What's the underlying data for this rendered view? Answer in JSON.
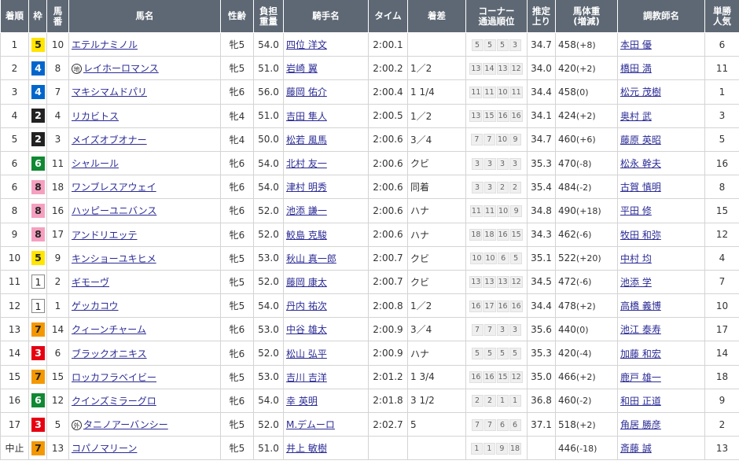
{
  "headers": [
    "着順",
    "枠",
    "馬\n番",
    "馬名",
    "性齢",
    "負担\n重量",
    "騎手名",
    "タイム",
    "着差",
    "コーナー\n通過順位",
    "推定\n上り",
    "馬体重\n(増減)",
    "調教師名",
    "単勝\n人気"
  ],
  "rows": [
    {
      "rank": "1",
      "frame": "5",
      "num": "10",
      "mark": "",
      "horse": "エテルナミノル",
      "sexage": "牝5",
      "weight": "54.0",
      "jockey": "四位 洋文",
      "time": "2:00.1",
      "margin": "",
      "corner": [
        "5",
        "5",
        "5",
        "3"
      ],
      "last3f": "34.7",
      "body": "458",
      "diff": "(+8)",
      "trainer": "本田 優",
      "pop": "6"
    },
    {
      "rank": "2",
      "frame": "4",
      "num": "8",
      "mark": "地",
      "horse": "レイホーロマンス",
      "sexage": "牝5",
      "weight": "51.0",
      "jockey": "岩崎 翼",
      "time": "2:00.2",
      "margin": "1／2",
      "corner": [
        "13",
        "14",
        "13",
        "12"
      ],
      "last3f": "34.0",
      "body": "420",
      "diff": "(+2)",
      "trainer": "橋田 満",
      "pop": "11"
    },
    {
      "rank": "3",
      "frame": "4",
      "num": "7",
      "mark": "",
      "horse": "マキシマムドパリ",
      "sexage": "牝6",
      "weight": "56.0",
      "jockey": "藤岡 佑介",
      "time": "2:00.4",
      "margin": "1 1/4",
      "corner": [
        "11",
        "11",
        "10",
        "11"
      ],
      "last3f": "34.4",
      "body": "458",
      "diff": "(0)",
      "trainer": "松元 茂樹",
      "pop": "1"
    },
    {
      "rank": "4",
      "frame": "2",
      "num": "4",
      "mark": "",
      "horse": "リカビトス",
      "sexage": "牝4",
      "weight": "51.0",
      "jockey": "吉田 隼人",
      "time": "2:00.5",
      "margin": "1／2",
      "corner": [
        "13",
        "15",
        "16",
        "16"
      ],
      "last3f": "34.1",
      "body": "424",
      "diff": "(+2)",
      "trainer": "奥村 武",
      "pop": "3"
    },
    {
      "rank": "5",
      "frame": "2",
      "num": "3",
      "mark": "",
      "horse": "メイズオブオナー",
      "sexage": "牝4",
      "weight": "50.0",
      "jockey": "松若 風馬",
      "time": "2:00.6",
      "margin": "3／4",
      "corner": [
        "7",
        "7",
        "10",
        "9"
      ],
      "last3f": "34.7",
      "body": "460",
      "diff": "(+6)",
      "trainer": "藤原 英昭",
      "pop": "5"
    },
    {
      "rank": "6",
      "frame": "6",
      "num": "11",
      "mark": "",
      "horse": "シャルール",
      "sexage": "牝6",
      "weight": "54.0",
      "jockey": "北村 友一",
      "time": "2:00.6",
      "margin": "クビ",
      "corner": [
        "3",
        "3",
        "3",
        "3"
      ],
      "last3f": "35.3",
      "body": "470",
      "diff": "(-8)",
      "trainer": "松永 幹夫",
      "pop": "16"
    },
    {
      "rank": "6",
      "frame": "8",
      "num": "18",
      "mark": "",
      "horse": "ワンブレスアウェイ",
      "sexage": "牝6",
      "weight": "54.0",
      "jockey": "津村 明秀",
      "time": "2:00.6",
      "margin": "同着",
      "corner": [
        "3",
        "3",
        "2",
        "2"
      ],
      "last3f": "35.4",
      "body": "484",
      "diff": "(-2)",
      "trainer": "古賀 慎明",
      "pop": "8"
    },
    {
      "rank": "8",
      "frame": "8",
      "num": "16",
      "mark": "",
      "horse": "ハッピーユニバンス",
      "sexage": "牝6",
      "weight": "52.0",
      "jockey": "池添 謙一",
      "time": "2:00.6",
      "margin": "ハナ",
      "corner": [
        "11",
        "11",
        "10",
        "9"
      ],
      "last3f": "34.8",
      "body": "490",
      "diff": "(+18)",
      "trainer": "平田 修",
      "pop": "15"
    },
    {
      "rank": "9",
      "frame": "8",
      "num": "17",
      "mark": "",
      "horse": "アンドリエッテ",
      "sexage": "牝6",
      "weight": "52.0",
      "jockey": "鮫島 克駿",
      "time": "2:00.6",
      "margin": "ハナ",
      "corner": [
        "18",
        "18",
        "16",
        "15"
      ],
      "last3f": "34.3",
      "body": "462",
      "diff": "(-6)",
      "trainer": "牧田 和弥",
      "pop": "12"
    },
    {
      "rank": "10",
      "frame": "5",
      "num": "9",
      "mark": "",
      "horse": "キンショーユキヒメ",
      "sexage": "牝5",
      "weight": "53.0",
      "jockey": "秋山 真一郎",
      "time": "2:00.7",
      "margin": "クビ",
      "corner": [
        "10",
        "10",
        "6",
        "5"
      ],
      "last3f": "35.1",
      "body": "522",
      "diff": "(+20)",
      "trainer": "中村 均",
      "pop": "4"
    },
    {
      "rank": "11",
      "frame": "1",
      "num": "2",
      "mark": "",
      "horse": "ギモーヴ",
      "sexage": "牝5",
      "weight": "52.0",
      "jockey": "藤岡 康太",
      "time": "2:00.7",
      "margin": "クビ",
      "corner": [
        "13",
        "13",
        "13",
        "12"
      ],
      "last3f": "34.5",
      "body": "472",
      "diff": "(-6)",
      "trainer": "池添 学",
      "pop": "7"
    },
    {
      "rank": "12",
      "frame": "1",
      "num": "1",
      "mark": "",
      "horse": "ゲッカコウ",
      "sexage": "牝5",
      "weight": "54.0",
      "jockey": "丹内 祐次",
      "time": "2:00.8",
      "margin": "1／2",
      "corner": [
        "16",
        "17",
        "16",
        "16"
      ],
      "last3f": "34.4",
      "body": "478",
      "diff": "(+2)",
      "trainer": "高橋 義博",
      "pop": "10"
    },
    {
      "rank": "13",
      "frame": "7",
      "num": "14",
      "mark": "",
      "horse": "クィーンチャーム",
      "sexage": "牝6",
      "weight": "53.0",
      "jockey": "中谷 雄太",
      "time": "2:00.9",
      "margin": "3／4",
      "corner": [
        "7",
        "7",
        "3",
        "3"
      ],
      "last3f": "35.6",
      "body": "440",
      "diff": "(0)",
      "trainer": "池江 泰寿",
      "pop": "17"
    },
    {
      "rank": "14",
      "frame": "3",
      "num": "6",
      "mark": "",
      "horse": "ブラックオニキス",
      "sexage": "牝6",
      "weight": "52.0",
      "jockey": "松山 弘平",
      "time": "2:00.9",
      "margin": "ハナ",
      "corner": [
        "5",
        "5",
        "5",
        "5"
      ],
      "last3f": "35.3",
      "body": "420",
      "diff": "(-4)",
      "trainer": "加藤 和宏",
      "pop": "14"
    },
    {
      "rank": "15",
      "frame": "7",
      "num": "15",
      "mark": "",
      "horse": "ロッカフラベイビー",
      "sexage": "牝5",
      "weight": "53.0",
      "jockey": "吉川 吉洋",
      "time": "2:01.2",
      "margin": "1 3/4",
      "corner": [
        "16",
        "16",
        "15",
        "12"
      ],
      "last3f": "35.0",
      "body": "466",
      "diff": "(+2)",
      "trainer": "鹿戸 雄一",
      "pop": "18"
    },
    {
      "rank": "16",
      "frame": "6",
      "num": "12",
      "mark": "",
      "horse": "クインズミラーグロ",
      "sexage": "牝6",
      "weight": "54.0",
      "jockey": "幸 英明",
      "time": "2:01.8",
      "margin": "3 1/2",
      "corner": [
        "2",
        "2",
        "1",
        "1"
      ],
      "last3f": "36.8",
      "body": "460",
      "diff": "(-2)",
      "trainer": "和田 正道",
      "pop": "9"
    },
    {
      "rank": "17",
      "frame": "3",
      "num": "5",
      "mark": "外",
      "horse": "タニノアーバンシー",
      "sexage": "牝5",
      "weight": "52.0",
      "jockey": "M.デムーロ",
      "time": "2:02.7",
      "margin": "5",
      "corner": [
        "7",
        "7",
        "6",
        "6"
      ],
      "last3f": "37.1",
      "body": "518",
      "diff": "(+2)",
      "trainer": "角居 勝彦",
      "pop": "2"
    },
    {
      "rank": "中止",
      "frame": "7",
      "num": "13",
      "mark": "",
      "horse": "コパノマリーン",
      "sexage": "牝5",
      "weight": "51.0",
      "jockey": "井上 敏樹",
      "time": "",
      "margin": "",
      "corner": [
        "1",
        "1",
        "9",
        "18"
      ],
      "last3f": "",
      "body": "446",
      "diff": "(-18)",
      "trainer": "斎藤 誠",
      "pop": "13"
    }
  ],
  "colors": {
    "header_bg": "#5e6874",
    "link": "#2b2b96",
    "border": "#d4d4d4"
  }
}
